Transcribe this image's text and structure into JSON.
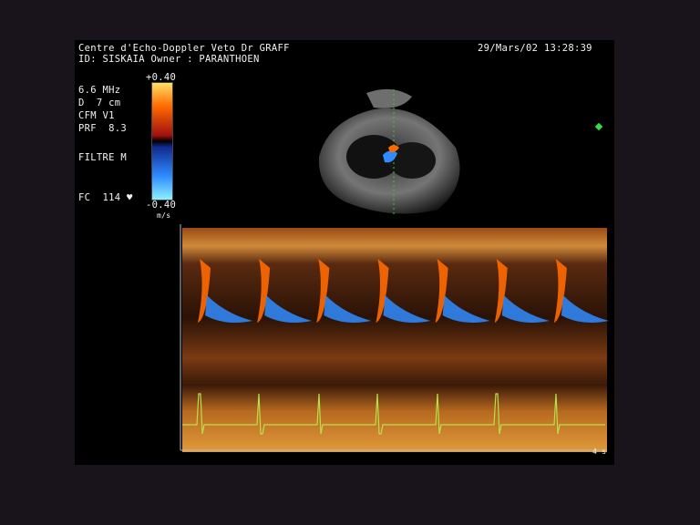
{
  "header": {
    "clinic": "Centre d'Echo-Doppler Veto Dr GRAFF",
    "patient": "ID: SISKAIA Owner : PARANTHOEN",
    "datetime": "29/Mars/02 13:28:39"
  },
  "settings": {
    "frequency": "6.6 MHz",
    "depth": "D  7 cm",
    "mode": "CFM V1",
    "prf": "PRF  8.3",
    "filter": "FILTRE M",
    "heart_rate": "FC  114 ♥"
  },
  "scale": {
    "max": "+0.40",
    "min": "-0.40",
    "unit": "m/s"
  },
  "time_marker": "4 s",
  "colors": {
    "background": "#19141c",
    "flow_positive": "#ff6a00",
    "flow_negative": "#2f8cff",
    "tissue": "#c07a2a",
    "ecg": "#b8e04a"
  }
}
